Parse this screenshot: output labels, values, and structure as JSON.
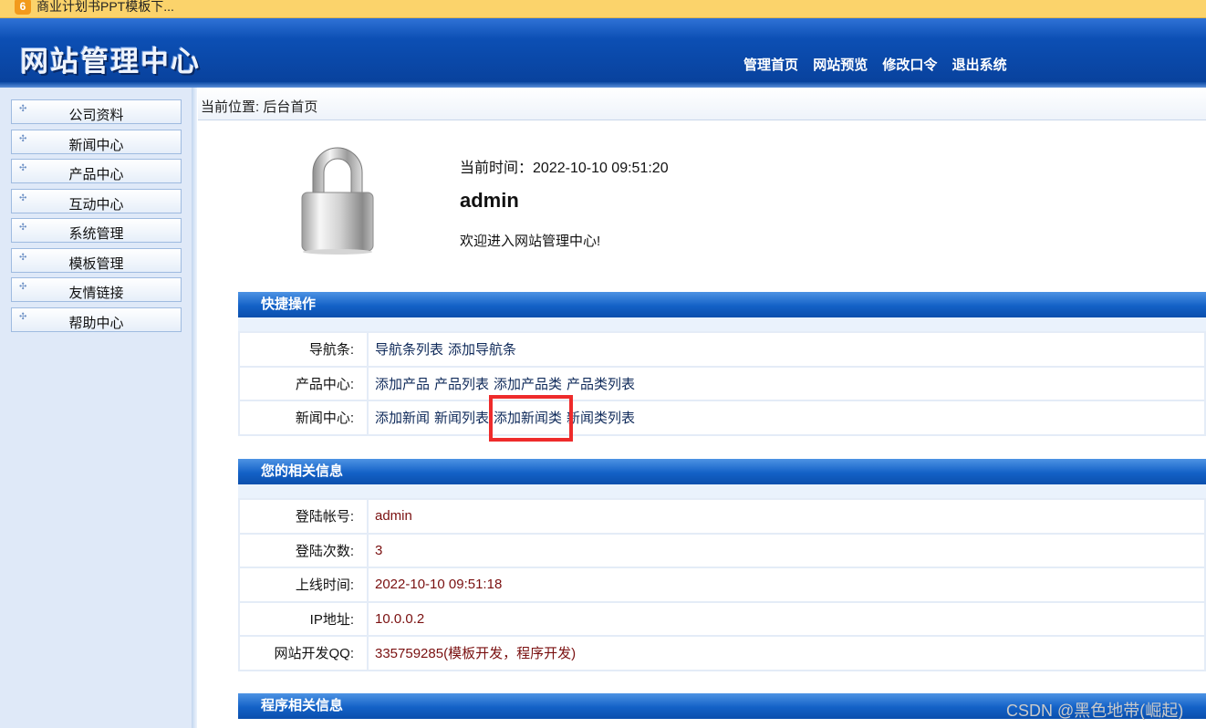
{
  "browser": {
    "tab_title": "商业计划书PPT模板下...",
    "tab_icon_glyph": "6"
  },
  "header": {
    "logo": "网站管理中心",
    "nav": [
      "管理首页",
      "网站预览",
      "修改口令",
      "退出系统"
    ]
  },
  "sidebar": {
    "items": [
      {
        "label": "公司资料"
      },
      {
        "label": "新闻中心"
      },
      {
        "label": "产品中心"
      },
      {
        "label": "互动中心"
      },
      {
        "label": "系统管理"
      },
      {
        "label": "模板管理"
      },
      {
        "label": "友情链接"
      },
      {
        "label": "帮助中心"
      }
    ]
  },
  "breadcrumb": "当前位置: 后台首页",
  "welcome": {
    "icon": "lock-icon",
    "time_label": "当前时间：",
    "time_value": "2022-10-10 09:51:20",
    "username": "admin",
    "message": "欢迎进入网站管理中心!"
  },
  "quick_ops": {
    "title": "快捷操作",
    "rows": [
      {
        "key": "导航条:",
        "links": [
          "导航条列表",
          "添加导航条"
        ]
      },
      {
        "key": "产品中心:",
        "links": [
          "添加产品",
          "产品列表",
          "添加产品类",
          "产品类列表"
        ]
      },
      {
        "key": "新闻中心:",
        "links": [
          "添加新闻",
          "新闻列表",
          "添加新闻类",
          "新闻类列表"
        ]
      }
    ]
  },
  "user_info": {
    "title": "您的相关信息",
    "rows": [
      {
        "key": "登陆帐号:",
        "value": "admin"
      },
      {
        "key": "登陆次数:",
        "value": "3"
      },
      {
        "key": "上线时间:",
        "value": "2022-10-10 09:51:18"
      },
      {
        "key": "IP地址:",
        "value": "10.0.0.2"
      },
      {
        "key": "网站开发QQ:",
        "value": "335759285(模板开发，程序开发)"
      }
    ]
  },
  "program_info": {
    "title": "程序相关信息"
  },
  "highlight_color": "#ee2b2b",
  "watermark": "CSDN @黑色地带(崛起)"
}
